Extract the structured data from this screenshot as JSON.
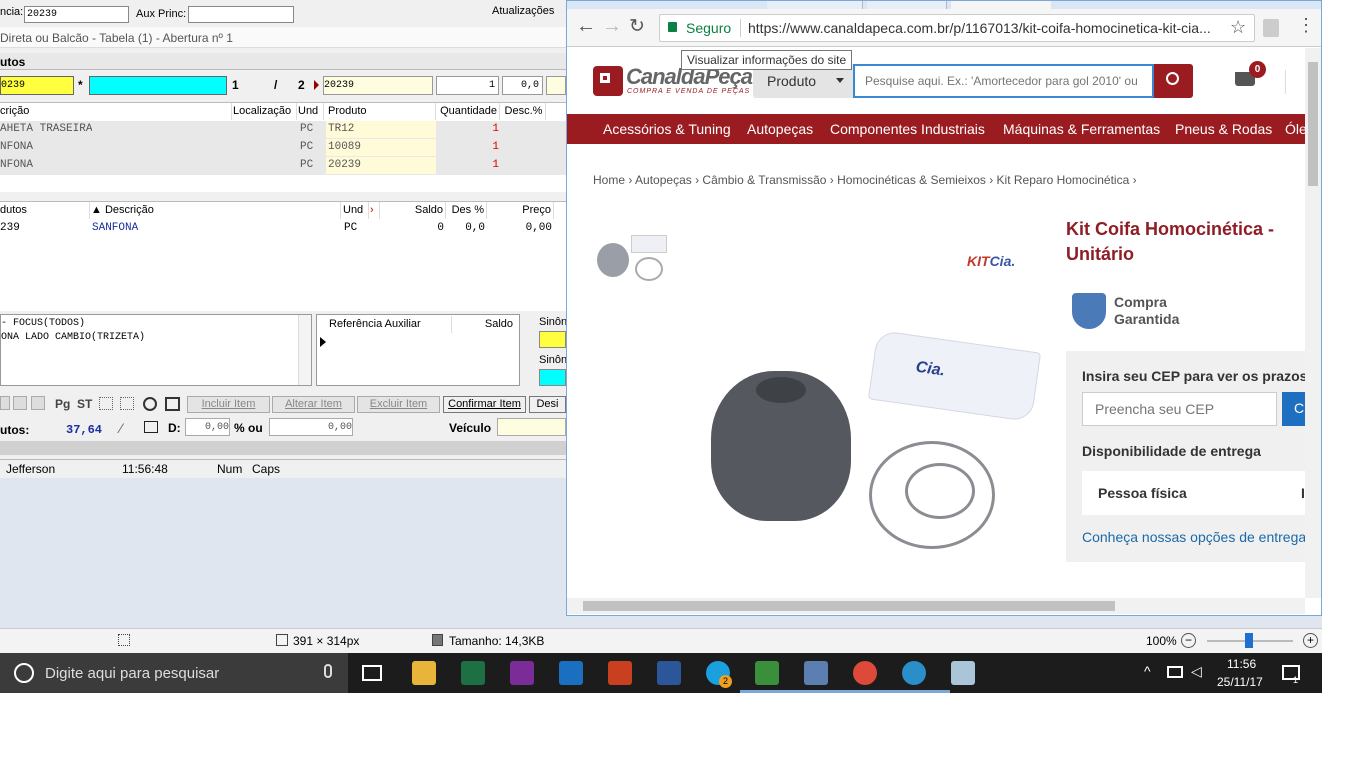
{
  "erp": {
    "top_label_ref": "ncia:",
    "top_ref_value": "20239",
    "aux_princ_label": "Aux Princ:",
    "atualizacoes": "Atualizações",
    "subtitle": "Direta ou  Balcão - Tabela (1) - Abertura nº 1",
    "section_title": "utos",
    "code_input": "0239",
    "star": "*",
    "item_counter_a": "1",
    "item_counter_sep": "/",
    "item_counter_b": "2",
    "produto_input": "20239",
    "qty_input": "1",
    "desc_input": "0,0",
    "grid_headers": [
      "crição",
      "Localização",
      "Und",
      "Produto",
      "Quantidade",
      "Desc.%"
    ],
    "rows": [
      {
        "desc": "AHETA TRASEIRA",
        "und": "PC",
        "prod": "TR12",
        "qty": "1"
      },
      {
        "desc": "NFONA",
        "und": "PC",
        "prod": "10089",
        "qty": "1"
      },
      {
        "desc": "NFONA",
        "und": "PC",
        "prod": "20239",
        "qty": "1"
      }
    ],
    "search_headers": [
      "dutos",
      "▲ Descrição",
      "Und",
      "Saldo",
      "Des %",
      "Preço"
    ],
    "search_row": {
      "code": "239",
      "desc": "SANFONA",
      "und": "PC",
      "saldo": "0",
      "des": "0,0",
      "preco": "0,00"
    },
    "notes_line1": "- FOCUS(TODOS)",
    "notes_line2": "ONA LADO CAMBIO(TRIZETA)",
    "ref_aux_header": "Referência Auxiliar",
    "saldo_header": "Saldo",
    "sinon1": "Sinôn",
    "sinon2": "Sinôn",
    "toolbar_pg": "Pg",
    "toolbar_st": "ST",
    "btn_incluir": "Incluir Item",
    "btn_alterar": "Alterar Item",
    "btn_excluir": "Excluir Item",
    "btn_confirmar": "Confirmar Item",
    "btn_desi": "Desi",
    "total_label": "utos:",
    "total_value": "37,64",
    "d_label": "D:",
    "d_value": "0,00",
    "pct_label": "% ou",
    "pct_value": "0,00",
    "veiculo_label": "Veículo",
    "status_user": "Jefferson",
    "status_time": "11:56:48",
    "status_num": "Num",
    "status_caps": "Caps"
  },
  "bottom_bar": {
    "dimensions": "391 × 314px",
    "size": "Tamanho: 14,3KB",
    "zoom": "100%"
  },
  "browser": {
    "secure_label": "Seguro",
    "url": "https://www.canaldapeca.com.br/p/1167013/kit-coifa-homocinetica-kit-cia...",
    "tooltip": "Visualizar informações do site",
    "logo_main": "CanaldaPeça",
    "logo_sub": "COMPRA E VENDA DE PEÇAS",
    "search_category": "Produto",
    "search_placeholder": "Pesquise aqui. Ex.: 'Amortecedor para gol 2010' ou",
    "cart_count": "0",
    "nav": [
      "Acessórios & Tuning",
      "Autopeças",
      "Componentes Industriais",
      "Máquinas & Ferramentas",
      "Pneus & Rodas",
      "Óle"
    ],
    "breadcrumb": [
      "Home",
      "Autopeças",
      "Câmbio & Transmissão",
      "Homocinéticas & Semieixos",
      "Kit Reparo Homocinética"
    ],
    "product_title_1": "Kit Coifa Homocinética -",
    "product_title_2": "Unitário",
    "compra_1": "Compra",
    "compra_2": "Garantida",
    "cep_heading": "Insira seu CEP para ver os prazos",
    "cep_placeholder": "Preencha seu CEP",
    "cep_button": "C",
    "disponibilidade": "Disponibilidade de entrega",
    "pessoa_fisica": "Pessoa física",
    "pessoa_fisica_r": "I",
    "conheca": "Conheça nossas opções de entrega",
    "brand_badge": "Cia.",
    "bag_label": "Cia."
  },
  "taskbar": {
    "search_placeholder": "Digite aqui para pesquisar",
    "time": "11:56",
    "date": "25/11/17",
    "notif_count": "1",
    "skype_badge": "2"
  },
  "colors": {
    "brand_red": "#9a1c20",
    "title_red": "#8f1d25",
    "link_blue": "#1a69a8",
    "yellow": "#ffff40",
    "cyan": "#00ffff"
  }
}
